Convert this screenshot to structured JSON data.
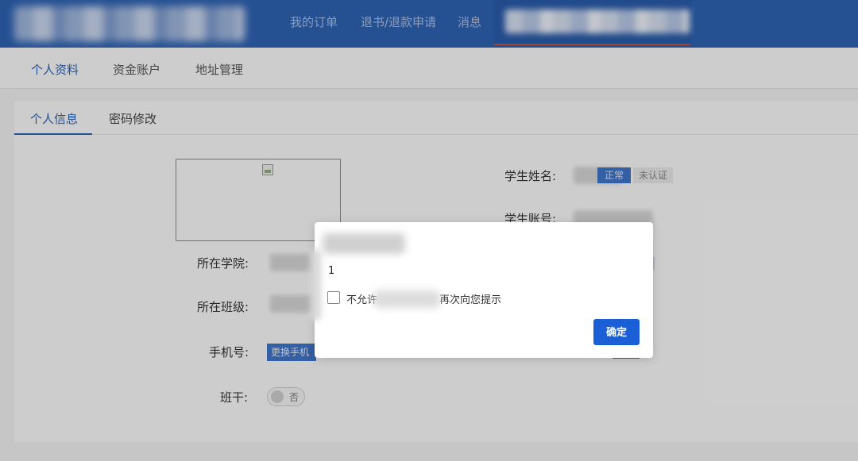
{
  "header": {
    "nav": [
      "我的订单",
      "退书/退款申请",
      "消息"
    ]
  },
  "subnav": {
    "items": [
      "个人资料",
      "资金账户",
      "地址管理"
    ],
    "active_index": 0
  },
  "tabs": {
    "items": [
      "个人信息",
      "密码修改"
    ],
    "active_index": 0
  },
  "profile": {
    "student_name_label": "学生姓名:",
    "student_account_label": "学生账号:",
    "college_label": "所在学院:",
    "class_label": "所在班级:",
    "phone_label": "手机号:",
    "class_cadre_label": "班干:",
    "status_badge": "正常",
    "verify_badge": "未认证",
    "change_phone_button": "更换手机",
    "class_cadre_toggle": "否"
  },
  "dialog": {
    "message": "1",
    "checkbox_label_prefix": "不允许",
    "checkbox_label_suffix": "再次向您提示",
    "checkbox_checked": false,
    "confirm_button": "确定"
  },
  "colors": {
    "header_bg": "#2e63b4",
    "accent": "#1a5fd6"
  }
}
